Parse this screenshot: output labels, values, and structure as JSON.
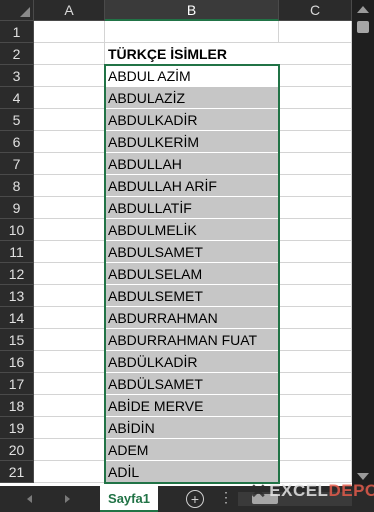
{
  "columns": [
    "A",
    "B",
    "C"
  ],
  "selected_column": "B",
  "rows": [
    "1",
    "2",
    "3",
    "4",
    "5",
    "6",
    "7",
    "8",
    "9",
    "10",
    "11",
    "12",
    "13",
    "14",
    "15",
    "16",
    "17",
    "18",
    "19",
    "20",
    "21"
  ],
  "cells_b": {
    "title": "TÜRKÇE İSİMLER",
    "names": [
      "ABDUL AZİM",
      "ABDULAZİZ",
      "ABDULKADİR",
      "ABDULKERİM",
      "ABDULLAH",
      "ABDULLAH ARİF",
      "ABDULLATİF",
      "ABDULMELİK",
      "ABDULSAMET",
      "ABDULSELAM",
      "ABDULSEMET",
      "ABDURRAHMAN",
      "ABDURRAHMAN FUAT",
      "ABDÜLKADİR",
      "ABDÜLSAMET",
      "ABİDE MERVE",
      "ABİDİN",
      "ADEM",
      "ADİL"
    ]
  },
  "sheet_tab": "Sayfa1",
  "add_sheet_symbol": "+",
  "more_symbol": "⋮",
  "watermark": {
    "prefix": "EXCEL",
    "suffix": "DEPO"
  },
  "colors": {
    "selection_border": "#217346",
    "selection_fill": "#c6c6c6",
    "header_bg": "#2b2b2b",
    "brand_red": "#e35b4b"
  },
  "icons": {
    "corner": "select-all-triangle-icon",
    "scroll": "scroll-arrow-icon",
    "add": "add-sheet-icon",
    "logo": "excel-depo-logo-icon"
  }
}
